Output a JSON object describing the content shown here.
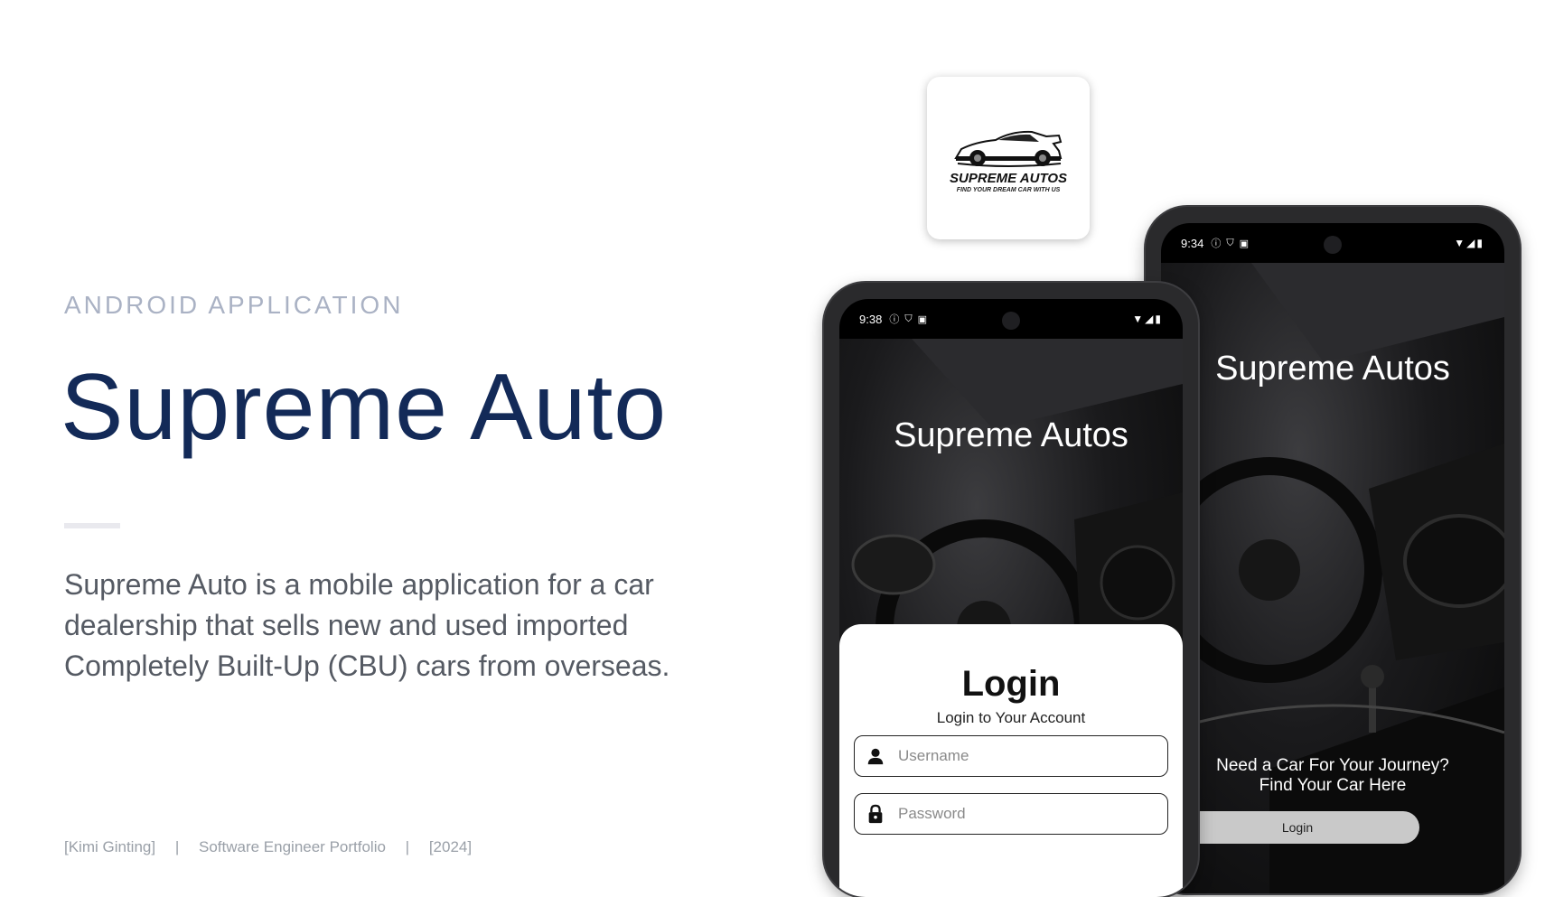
{
  "slide": {
    "kicker": "ANDROID APPLICATION",
    "title": "Supreme Auto",
    "description": "Supreme Auto is a mobile application for a car dealership that sells new and used imported Completely Built-Up (CBU) cars from overseas.",
    "footer": {
      "author": "[Kimi Ginting]",
      "separator": "|",
      "portfolio": "Software Engineer Portfolio",
      "year": "[2024]"
    }
  },
  "app_icon": {
    "brand": "SUPREME AUTOS",
    "tagline": "FIND YOUR DREAM CAR WITH US"
  },
  "login_phone": {
    "status_time": "9:38",
    "app_title": "Supreme Autos",
    "login_heading": "Login",
    "login_subtitle": "Login to Your Account",
    "username_placeholder": "Username",
    "password_placeholder": "Password"
  },
  "splash_phone": {
    "status_time": "9:34",
    "app_title": "Supreme Autos",
    "tagline_line1": "Need a Car For Your Journey?",
    "tagline_line2": "Find Your Car Here",
    "login_button": "Login"
  },
  "icons": [
    "person-icon",
    "lock-icon",
    "wifi-icon",
    "signal-icon",
    "battery-icon",
    "info-icon",
    "shield-icon",
    "car-logo"
  ]
}
